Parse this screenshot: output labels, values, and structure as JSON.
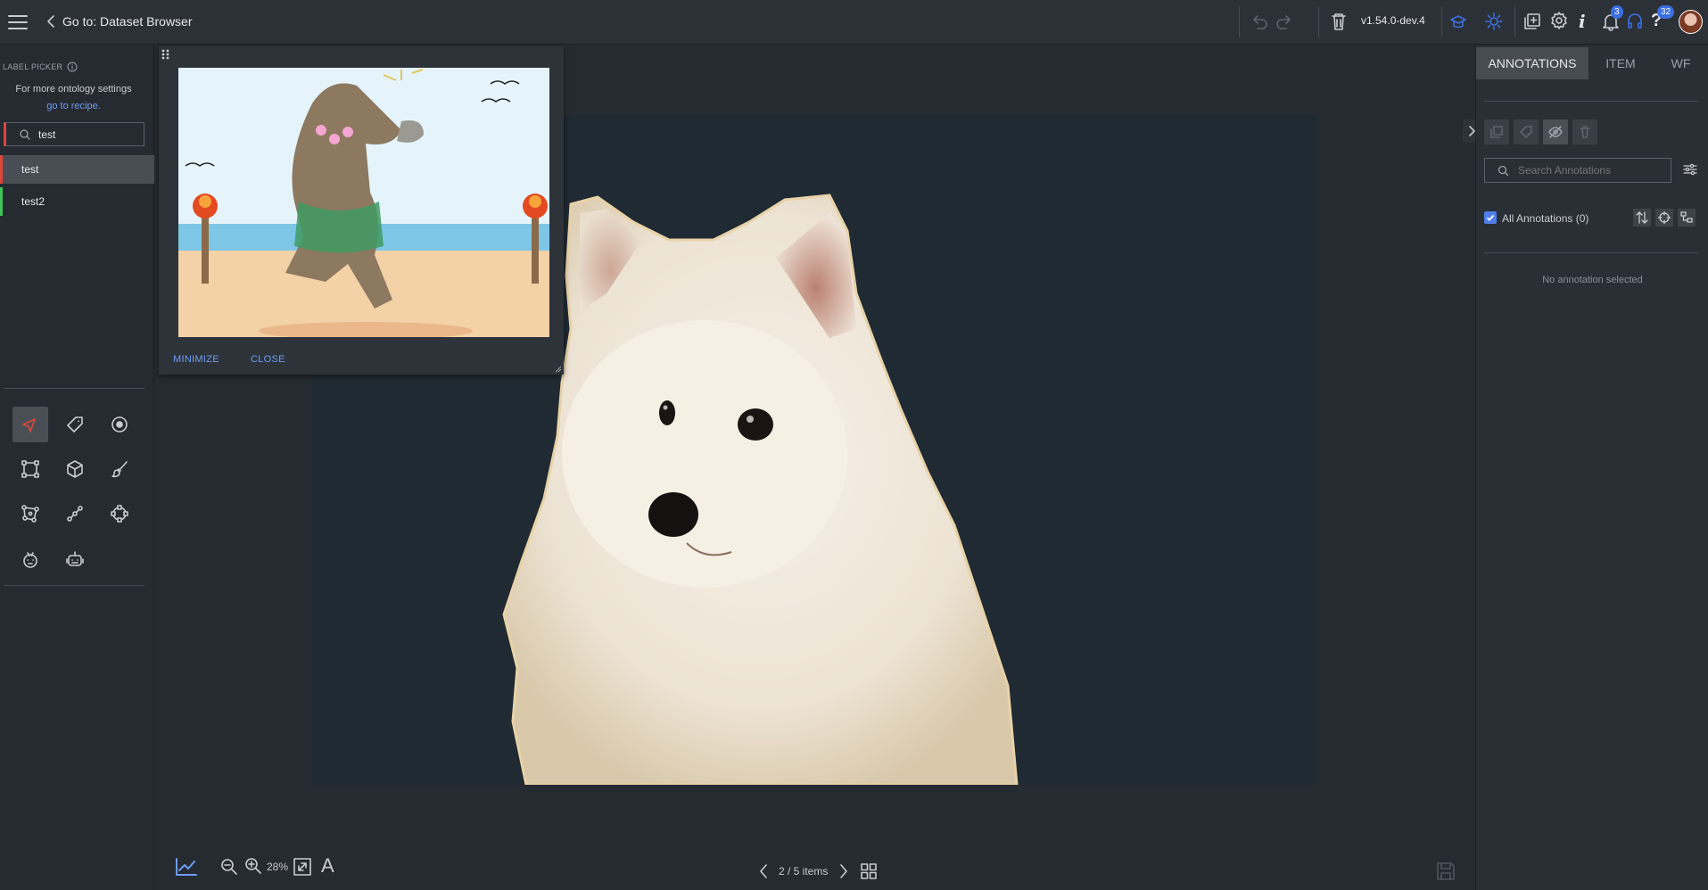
{
  "header": {
    "back_label": "Go to: Dataset Browser",
    "version": "v1.54.0-dev.4",
    "notifications_count": "3",
    "help_count": "32"
  },
  "label_picker": {
    "title": "LABEL PICKER",
    "ontology_text": "For more ontology settings",
    "recipe_link": "go to recipe.",
    "search_value": "test",
    "labels": [
      {
        "name": "test",
        "color": "#e0453a"
      },
      {
        "name": "test2",
        "color": "#3ec45a"
      }
    ]
  },
  "preview_popup": {
    "minimize_label": "MINIMIZE",
    "close_label": "CLOSE"
  },
  "bottom_bar": {
    "zoom_level": "28%",
    "pagination": "2 / 5 items"
  },
  "right_panel": {
    "tabs": [
      "ANNOTATIONS",
      "ITEM",
      "WF"
    ],
    "search_placeholder": "Search Annotations",
    "all_annotations_label": "All Annotations (0)",
    "empty_state": "No annotation selected"
  },
  "colors": {
    "accent": "#3b6fe0",
    "link": "#6e9cf2",
    "background": "#262b31"
  }
}
